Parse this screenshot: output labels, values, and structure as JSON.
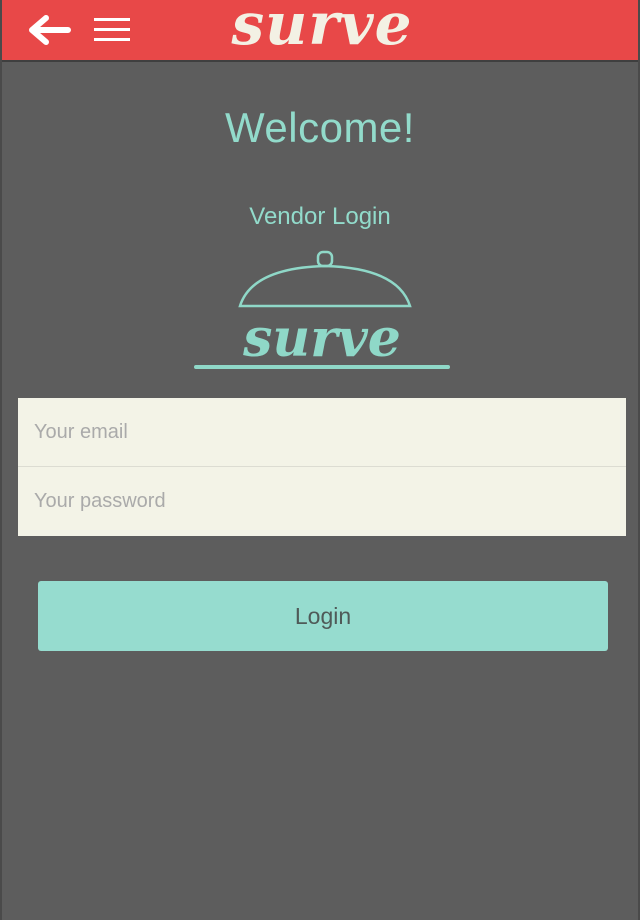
{
  "header": {
    "brand_text": "surve",
    "back_icon": "arrow-left-icon",
    "menu_icon": "hamburger-menu-icon",
    "background_color": "#e84848"
  },
  "main": {
    "title": "Welcome!",
    "subtitle": "Vendor Login",
    "logo": {
      "text": "surve",
      "icon": "cloche-icon"
    }
  },
  "login_form": {
    "email": {
      "value": "",
      "placeholder": "Your email"
    },
    "password": {
      "value": "",
      "placeholder": "Your password"
    },
    "login_label": "Login"
  },
  "colors": {
    "accent": "#96dccf",
    "background": "#5d5d5d",
    "header": "#e84848",
    "input_background": "#f3f3e7"
  }
}
